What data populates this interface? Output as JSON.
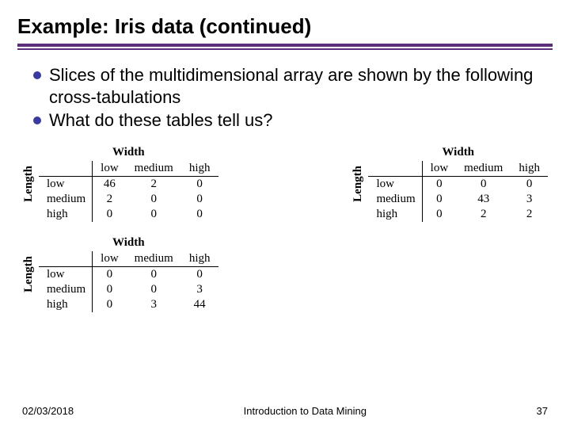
{
  "title": "Example: Iris data (continued)",
  "bullets": {
    "b1": "Slices of the multidimensional array are shown by the following cross-tabulations",
    "b2": "What do these tables tell us?"
  },
  "labels": {
    "width": "Width",
    "length": "Length",
    "low": "low",
    "medium": "medium",
    "high": "high"
  },
  "chart_data": [
    {
      "type": "table",
      "row_labels": [
        "low",
        "medium",
        "high"
      ],
      "col_labels": [
        "low",
        "medium",
        "high"
      ],
      "values": [
        [
          46,
          2,
          0
        ],
        [
          2,
          0,
          0
        ],
        [
          0,
          0,
          0
        ]
      ]
    },
    {
      "type": "table",
      "row_labels": [
        "low",
        "medium",
        "high"
      ],
      "col_labels": [
        "low",
        "medium",
        "high"
      ],
      "values": [
        [
          0,
          0,
          0
        ],
        [
          0,
          43,
          3
        ],
        [
          0,
          2,
          2
        ]
      ]
    },
    {
      "type": "table",
      "row_labels": [
        "low",
        "medium",
        "high"
      ],
      "col_labels": [
        "low",
        "medium",
        "high"
      ],
      "values": [
        [
          0,
          0,
          0
        ],
        [
          0,
          0,
          3
        ],
        [
          0,
          3,
          44
        ]
      ]
    }
  ],
  "footer": {
    "date": "02/03/2018",
    "course": "Introduction to Data Mining",
    "page": "37"
  }
}
